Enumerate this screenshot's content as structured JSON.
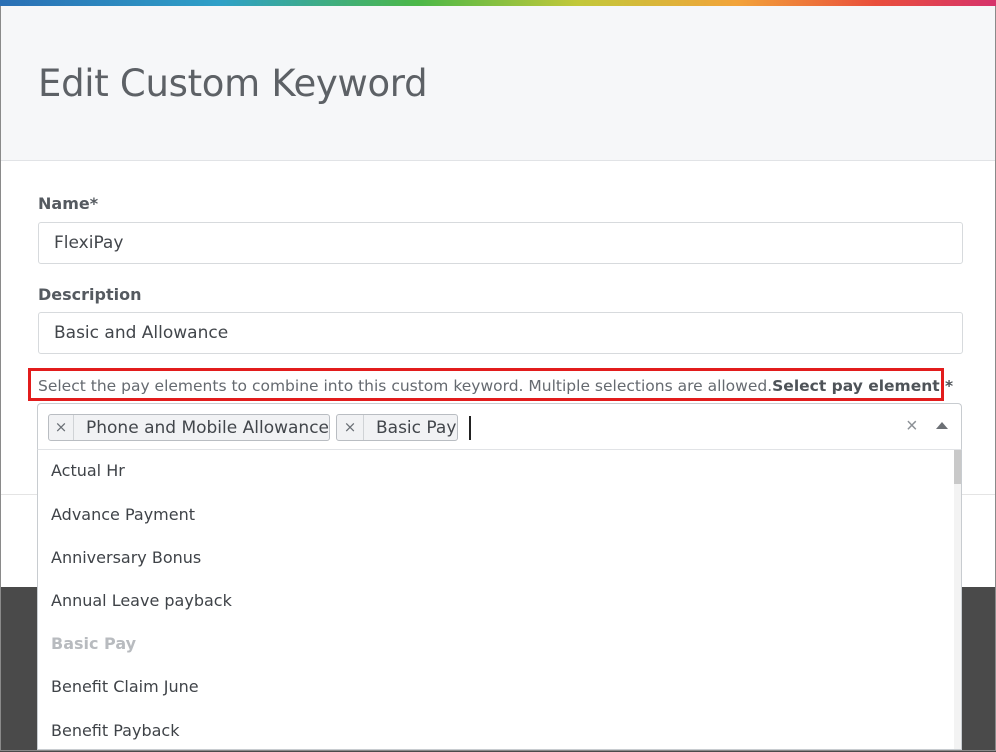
{
  "dialog": {
    "title": "Edit Custom Keyword"
  },
  "form": {
    "name": {
      "label": "Name*",
      "value": "FlexiPay"
    },
    "description": {
      "label": "Description",
      "value": "Basic and Allowance"
    },
    "hint": {
      "text": "Select the pay elements to combine into this custom keyword. Multiple selections are allowed.",
      "required_label": "Select pay element *"
    }
  },
  "pay_element_select": {
    "selected": [
      {
        "label": "Phone and Mobile Allowance",
        "remove_icon": "×"
      },
      {
        "label": "Basic Pay",
        "remove_icon": "×"
      }
    ],
    "clear_icon": "×",
    "options": [
      {
        "label": "Actual Hr",
        "disabled": false
      },
      {
        "label": "Advance Payment",
        "disabled": false
      },
      {
        "label": "Anniversary Bonus",
        "disabled": false
      },
      {
        "label": "Annual Leave payback",
        "disabled": false
      },
      {
        "label": "Basic Pay",
        "disabled": true
      },
      {
        "label": "Benefit Claim June",
        "disabled": false
      },
      {
        "label": "Benefit Payback",
        "disabled": false
      }
    ]
  },
  "colors": {
    "highlight_border": "#e21c1c",
    "header_bg": "#f6f7f9",
    "disabled_option": "#b8bbbf"
  }
}
